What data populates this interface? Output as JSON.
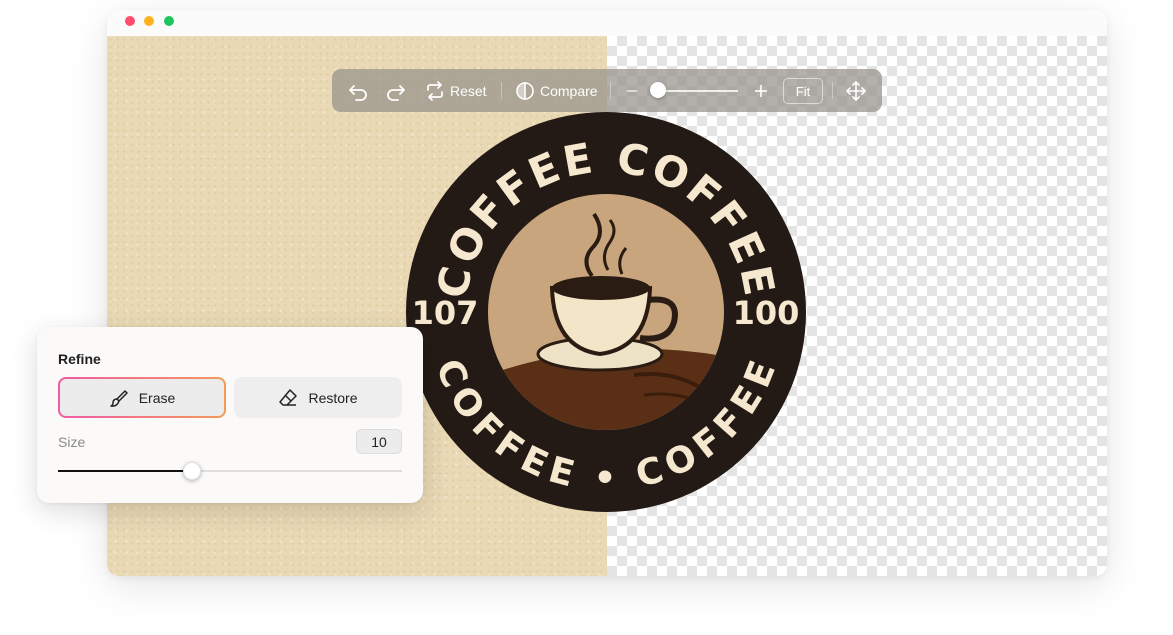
{
  "window": {
    "controls": [
      "close",
      "minimize",
      "maximize"
    ]
  },
  "toolbar": {
    "undo_icon": "undo-icon",
    "redo_icon": "redo-icon",
    "reset_label": "Reset",
    "compare_label": "Compare",
    "zoom_level": 0.08,
    "fit_label": "Fit",
    "move_icon": "move-icon"
  },
  "logo": {
    "top_text": "COFFEE COFFEE",
    "bottom_text": "COFFEE • COFFEE",
    "left_number": "107",
    "right_number": "100",
    "colors": {
      "ring": "#241a15",
      "text": "#f6e8cf",
      "inner": "#c8a57c",
      "table": "#5a2f16"
    }
  },
  "refine": {
    "title": "Refine",
    "erase_label": "Erase",
    "restore_label": "Restore",
    "active_mode": "Erase",
    "size_label": "Size",
    "size_value": "10",
    "size_slider_fraction": 0.39,
    "active_colors": [
      "#f05aa7",
      "#f39a5a"
    ]
  }
}
